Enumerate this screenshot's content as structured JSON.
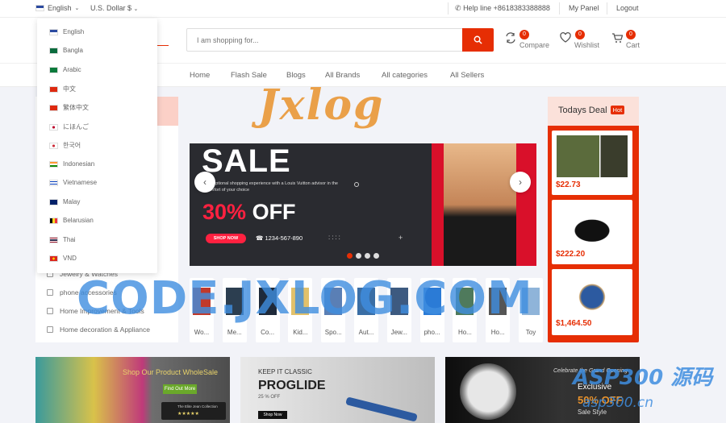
{
  "topbar": {
    "language": "English",
    "currency": "U.S. Dollar $",
    "help": "Help line +8618383388888",
    "my_panel": "My Panel",
    "logout": "Logout"
  },
  "languages": [
    "English",
    "Bangla",
    "Arabic",
    "中文",
    "繁体中文",
    "にほんご",
    "한국어",
    "Indonesian",
    "Vietnamese",
    "Malay",
    "Belarusian",
    "Thai",
    "VND"
  ],
  "search": {
    "placeholder": "I am shopping for..."
  },
  "header_icons": {
    "compare_label": "Compare",
    "compare_count": "0",
    "wishlist_label": "Wishlist",
    "wishlist_count": "0",
    "cart_label": "Cart",
    "cart_count": "0"
  },
  "nav": [
    "Home",
    "Flash Sale",
    "Blogs",
    "All Brands",
    "All categories",
    "All Sellers"
  ],
  "sidebar_categories": [
    "Jewelry & Watches",
    "phone accessories",
    "Home Improvement & Tools",
    "Home decoration & Appliance"
  ],
  "slider": {
    "title": "SALE",
    "desc": "Exceptional shopping experience with a Louis Vuitton advisor in the comfort of your choice",
    "off_pct": "30%",
    "off_word": "OFF",
    "shop_btn": "SHOP NOW",
    "phone": "1234-567-890",
    "slides_total": 4,
    "active_slide": 1
  },
  "todays_deal": {
    "title": "Todays Deal",
    "hot": "Hot",
    "items": [
      {
        "price": "$22.73"
      },
      {
        "price": "$222.20"
      },
      {
        "price": "$1,464.50"
      }
    ]
  },
  "home_categories": [
    "Wo...",
    "Me...",
    "Co...",
    "Kid...",
    "Spo...",
    "Aut...",
    "Jew...",
    "pho...",
    "Ho...",
    "Ho...",
    "Toy"
  ],
  "banners": [
    {
      "title": "Shop Our Product WholeSale",
      "btn": "Find Out More",
      "note": "The Elite Jean Collection"
    },
    {
      "eyebrow": "KEEP IT CLASSIC",
      "title": "PROGLIDE",
      "sub": "25 % OFF",
      "btn": "Shop Now"
    },
    {
      "eyebrow": "Celebrate the Grand Opening",
      "title": "Exclusive",
      "off": "50% OFF",
      "sub": "Sale Style"
    }
  ],
  "watermarks": {
    "jxlog": "Jxlog",
    "code": "CODE.JXLOG.COM",
    "asp": "ASP300 源码",
    "asp_url": "asp300.cn"
  },
  "colors": {
    "accent": "#e62e04",
    "watermark_blue": "#3f8ee0",
    "watermark_orange": "#e9922b"
  }
}
